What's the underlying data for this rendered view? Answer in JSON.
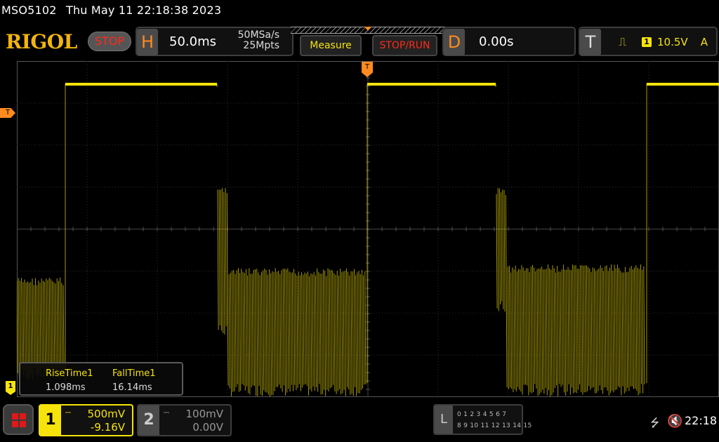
{
  "status": {
    "model": "MSO5102",
    "datetime": "Thu May 11 22:18:38 2023"
  },
  "header": {
    "logo": "RIGOL",
    "run_state": "STOP",
    "horizontal": {
      "letter": "H",
      "timebase": "50.0ms",
      "sample_rate": "50MSa/s",
      "memory_depth": "25Mpts"
    },
    "measure_label": "Measure",
    "stoprun_label": "STOP/RUN",
    "delay": {
      "letter": "D",
      "value": "0.00s"
    },
    "trigger": {
      "letter": "T",
      "source": "1",
      "level": "10.5V",
      "mode": "A"
    }
  },
  "markers": {
    "trigger_level": "T",
    "trigger_time": "T",
    "ch1_ground": "1"
  },
  "measurements": [
    {
      "name": "RiseTime1",
      "value": "1.098ms"
    },
    {
      "name": "FallTime1",
      "value": "16.14ms"
    }
  ],
  "channels": [
    {
      "number": "1",
      "scale": "500mV",
      "offset": "-9.16V",
      "coupling": "DC",
      "color": "#f6e30a"
    },
    {
      "number": "2",
      "scale": "100mV",
      "offset": "0.00V",
      "coupling": "DC",
      "color": "#999999"
    }
  ],
  "logic": {
    "letter": "L",
    "row1": "0 1 2 3  4 5 6 7",
    "row2": "8 9 10 11 12 13 14 15"
  },
  "system": {
    "time": "22:18",
    "usb_icon": "usb-icon",
    "mute_icon": "speaker-muted-icon"
  },
  "colors": {
    "ch1": "#f6e30a",
    "accent": "#ff8a1f",
    "stop": "#ff2a1a"
  }
}
